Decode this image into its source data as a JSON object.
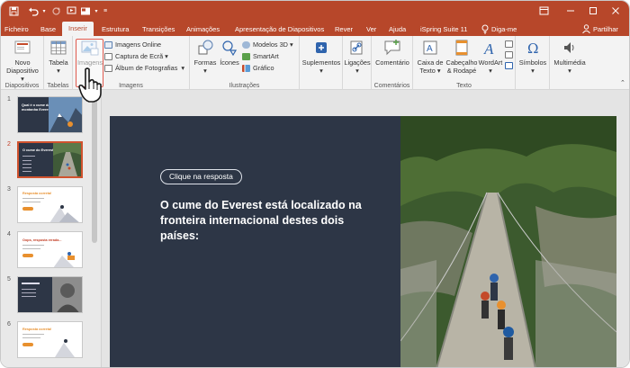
{
  "tabs": [
    "Ficheiro",
    "Base",
    "Inserir",
    "Estrutura",
    "Transições",
    "Animações",
    "Apresentação de Diapositivos",
    "Rever",
    "Ver",
    "Ajuda",
    "iSpring Suite 11",
    "Diga-me",
    "Partilhar"
  ],
  "ribbon": {
    "novo": "Novo",
    "diapositivo": "Diapositivo",
    "tabela": "Tabela",
    "imagens": "Imagens",
    "imagens_online": "Imagens Online",
    "captura": "Captura de Ecrã",
    "album": "Álbum de Fotografias",
    "formas": "Formas",
    "icones": "Ícones",
    "modelos3d": "Modelos 3D",
    "smartart": "SmartArt",
    "grafico": "Gráfico",
    "suplementos": "Suplementos",
    "ligacoes": "Ligações",
    "comentario": "Comentário",
    "caixa": "Caixa de",
    "texto": "Texto",
    "cabecalho": "Cabeçalho",
    "rodape": "& Rodapé",
    "wordart": "WordArt",
    "simbolos": "Símbolos",
    "multimedia": "Multimédia",
    "groups": {
      "diapositivos": "Diapositivos",
      "tabelas": "Tabelas",
      "imagens": "Imagens",
      "ilustracoes": "Ilustrações",
      "comentarios": "Comentários",
      "texto": "Texto"
    }
  },
  "thumbs": [
    {
      "num": "1",
      "title": "Qual é o cume da montanha Everest"
    },
    {
      "num": "2",
      "title": "O cume do Everest"
    },
    {
      "num": "3",
      "title": "Resposta correta!"
    },
    {
      "num": "4",
      "title": "Oops, resposta errada..."
    },
    {
      "num": "5",
      "title": ""
    },
    {
      "num": "6",
      "title": "Resposta correta!"
    }
  ],
  "slide": {
    "button": "Clique na resposta",
    "question": "O cume do Everest está localizado na fronteira internacional destes dois países:"
  },
  "colors": {
    "brand": "#b7472a",
    "slide_bg": "#2d3646",
    "accent": "#e8902e"
  }
}
